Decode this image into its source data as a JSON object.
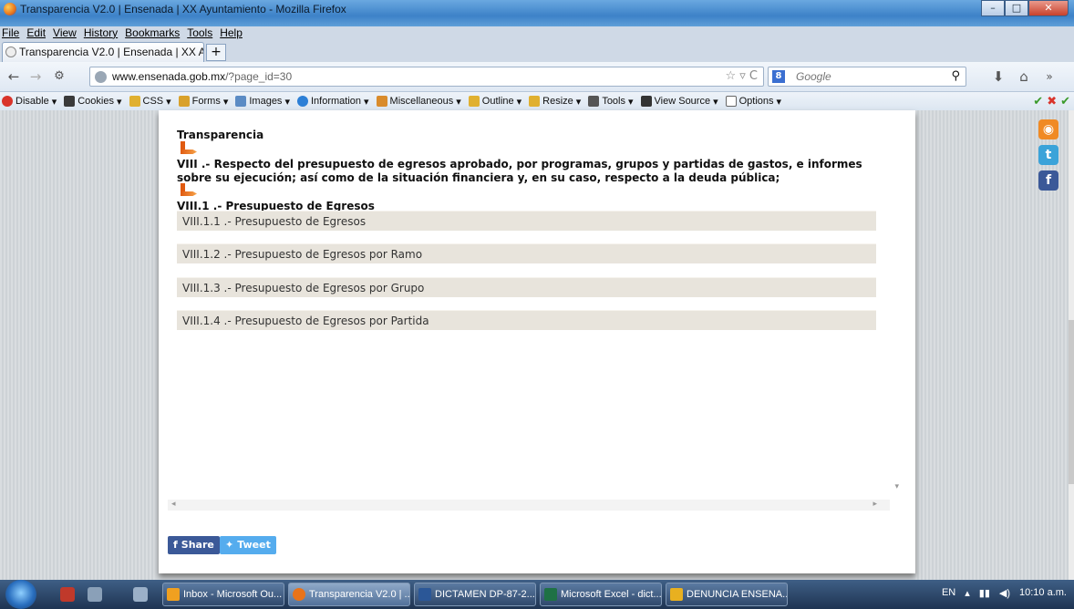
{
  "window": {
    "title": "Transparencia V2.0 | Ensenada | XX Ayuntamiento - Mozilla Firefox",
    "controls": {
      "minimize": "–",
      "maximize": "□",
      "close": "✕"
    }
  },
  "menu": [
    "File",
    "Edit",
    "View",
    "History",
    "Bookmarks",
    "Tools",
    "Help"
  ],
  "tabs": {
    "active_label": "Transparencia V2.0 | Ensenada | XX Ayun...",
    "new_tab": "+"
  },
  "nav": {
    "back": "←",
    "forward": "→",
    "url_domain": "www.ensenada.gob.mx",
    "url_path": "/?page_id=30",
    "url_controls": "☆ ▿ C",
    "search_engine": "8",
    "search_placeholder": "Google",
    "search_icon": "⚲",
    "download": "⬇",
    "home": "⌂"
  },
  "devtoolbar": {
    "items": [
      {
        "label": "Disable",
        "color": "#d9342b"
      },
      {
        "label": "Cookies",
        "color": "#3a3a3a"
      },
      {
        "label": "CSS",
        "color": "#e0b030"
      },
      {
        "label": "Forms",
        "color": "#d9a12b"
      },
      {
        "label": "Images",
        "color": "#5b8bc4"
      },
      {
        "label": "Information",
        "color": "#2c7fd6"
      },
      {
        "label": "Miscellaneous",
        "color": "#d98b2b"
      },
      {
        "label": "Outline",
        "color": "#e0b030"
      },
      {
        "label": "Resize",
        "color": "#e0b030"
      },
      {
        "label": "Tools",
        "color": "#555"
      },
      {
        "label": "View Source",
        "color": "#333"
      },
      {
        "label": "Options",
        "color": "#666"
      }
    ],
    "right_icons": [
      "✔",
      "✖",
      "✔"
    ]
  },
  "page": {
    "heading": "Transparencia",
    "section_title": "VIII .- Respecto del presupuesto de egresos aprobado, por programas, grupos y partidas de gastos, e informes sobre su ejecución; así como de la situación financiera y, en su caso, respecto a la deuda pública;",
    "subsection_title": "VIII.1 .- Presupuesto de Egresos",
    "links": [
      "VIII.1.1 .- Presupuesto de Egresos",
      "VIII.1.2 .- Presupuesto de Egresos por Ramo",
      "VIII.1.3 .- Presupuesto de Egresos por Grupo",
      "VIII.1.4 .- Presupuesto de Egresos por Partida"
    ],
    "share": {
      "facebook": "Share",
      "twitter": "Tweet"
    },
    "social": {
      "rss": "◉",
      "twitter": "t",
      "facebook": "f"
    }
  },
  "taskbar": {
    "buttons": [
      {
        "label": "Inbox - Microsoft Ou...",
        "color": "#f0a020"
      },
      {
        "label": "Transparencia V2.0 | ...",
        "color": "#e8731a",
        "active": true
      },
      {
        "label": "DICTAMEN DP-87-2...",
        "color": "#2b5797"
      },
      {
        "label": "Microsoft Excel - dict...",
        "color": "#1e7145"
      },
      {
        "label": "DENUNCIA ENSENA...",
        "color": "#e8b020"
      }
    ],
    "lang": "EN",
    "time": "10:10 a.m."
  }
}
